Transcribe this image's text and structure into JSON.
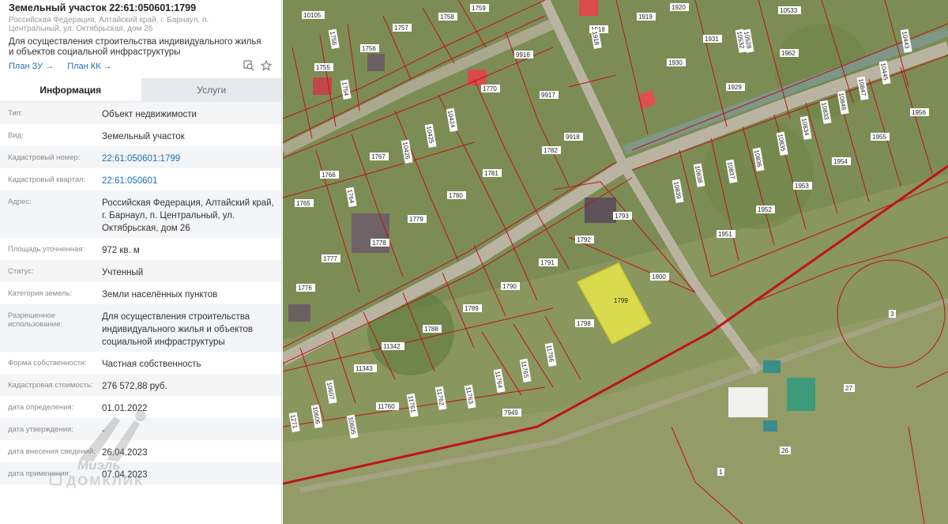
{
  "panel": {
    "title": "Земельный участок 22:61:050601:1799",
    "subaddress": "Российская Федерация, Алтайский край, г. Барнаул, п. Центральный, ул. Октябрьская, дом 26",
    "purpose": "Для осуществления строительства индивидуального жилья и объектов социальной инфраструктуры",
    "links": {
      "plan_zu": "План ЗУ →",
      "plan_kk": "План КК →"
    },
    "tools": {
      "search_icon": "search-map-icon",
      "star_icon": "star-icon"
    },
    "tabs": [
      {
        "label": "Информация",
        "active": true
      },
      {
        "label": "Услуги",
        "active": false
      }
    ],
    "rows": [
      {
        "label": "Тип:",
        "value": "Объект недвижимости"
      },
      {
        "label": "Вид:",
        "value": "Земельный участок"
      },
      {
        "label": "Кадастровый номер:",
        "value": "22:61:050601:1799",
        "link": true
      },
      {
        "label": "Кадастровый квартал:",
        "value": "22:61:050601",
        "link": true
      },
      {
        "label": "Адрес:",
        "value": "Российская Федерация, Алтайский край, г. Барнаул, п. Центральный, ул. Октябрьская, дом 26"
      },
      {
        "label": "Площадь уточненная:",
        "value": "972 кв. м"
      },
      {
        "label": "Статус:",
        "value": "Учтенный"
      },
      {
        "label": "Категория земель:",
        "value": "Земли населённых пунктов"
      },
      {
        "label": "Разрешенное использование:",
        "value": "Для осуществления строительства индивидуального жилья и объектов социальной инфраструктуры"
      },
      {
        "label": "Форма собственности:",
        "value": "Частная собственность"
      },
      {
        "label": "Кадастровая стоимость:",
        "value": "276 572,88 руб."
      },
      {
        "label": "дата определения:",
        "value": "01.01.2022"
      },
      {
        "label": "дата утверждения:",
        "value": "-"
      },
      {
        "label": "дата внесения сведений:",
        "value": "26.04.2023"
      },
      {
        "label": "дата применения:",
        "value": "07.04.2023"
      }
    ],
    "watermark": {
      "brand": "Миэль",
      "site": "ДОМКЛИК"
    }
  },
  "map": {
    "colors": {
      "boundary": "#c0121c",
      "selected": "#e8e84a",
      "road": "#b9b4a2"
    },
    "selected_parcel": "1799",
    "labels": [
      "10105",
      "1756",
      "1757",
      "1758",
      "1759",
      "1919",
      "1920",
      "10532",
      "10533",
      "1918",
      "1931",
      "10528",
      "1755",
      "1756",
      "9916",
      "1930",
      "1962",
      "10445",
      "10443",
      "1754",
      "1770",
      "9917",
      "1929",
      "1956",
      "10424",
      "10425",
      "10426",
      "1918",
      "10833",
      "10834",
      "10835",
      "10836",
      "10837",
      "10838",
      "10839",
      "10847",
      "10846",
      "1955",
      "1954",
      "1953",
      "1952",
      "1951",
      "1782",
      "9918",
      "1767",
      "1766",
      "1765",
      "1764",
      "1781",
      "1780",
      "1779",
      "1778",
      "1777",
      "1776",
      "1793",
      "1792",
      "1791",
      "1790",
      "1789",
      "1788",
      "1800",
      "1799",
      "1798",
      "11766",
      "11765",
      "11764",
      "11763",
      "11762",
      "11761",
      "11342",
      "11343",
      "10607",
      "10606",
      "10605",
      "11760",
      "7949",
      "1271",
      "3",
      "27",
      "26",
      "1"
    ]
  }
}
